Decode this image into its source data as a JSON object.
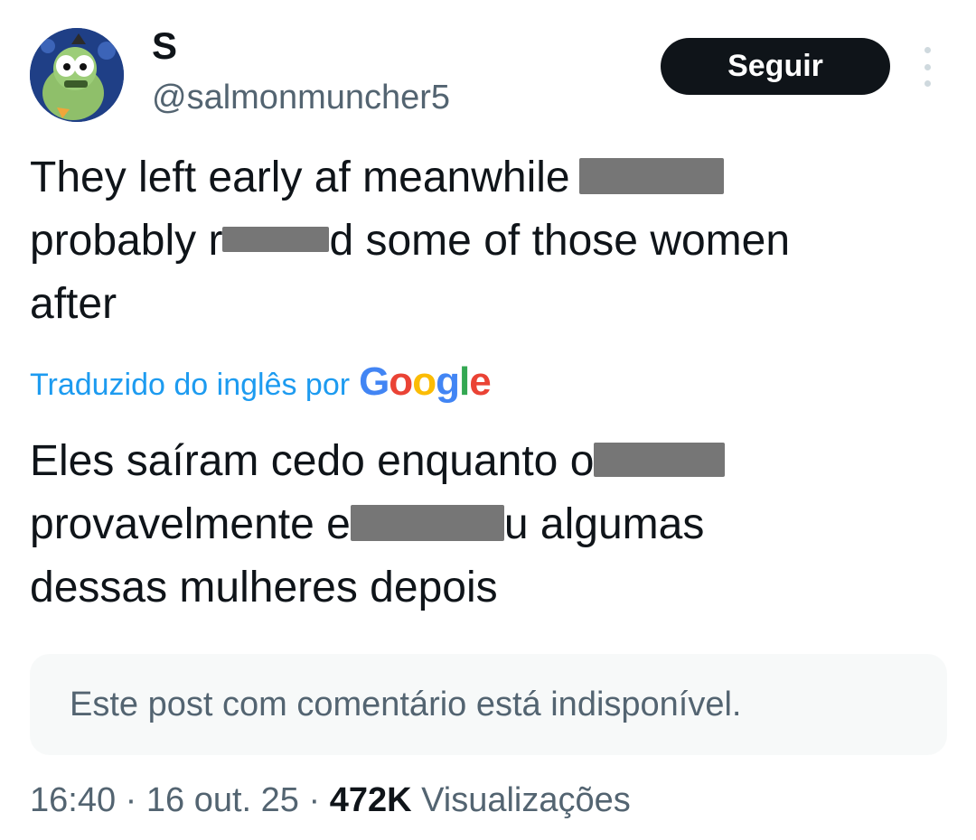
{
  "author": {
    "display_name": "S",
    "handle": "@salmonmuncher5"
  },
  "follow_button": {
    "label": "Seguir"
  },
  "tweet": {
    "segments": [
      "They left early af meanwhile",
      "probably r",
      "d some of those women",
      "after"
    ]
  },
  "translation": {
    "label": "Traduzido do inglês por",
    "provider": "Google",
    "segments": [
      "Eles saíram cedo enquanto o",
      "provavelmente e",
      "u algumas",
      "dessas mulheres depois"
    ]
  },
  "quoted_post": {
    "message": "Este post com comentário está indisponível."
  },
  "meta": {
    "time": "16:40",
    "separator": "·",
    "date": "16 out. 25",
    "views_count": "472K",
    "views_label": "Visualizações"
  },
  "colors": {
    "link": "#1d9bf0",
    "secondary_text": "#536471",
    "primary_text": "#0f1419",
    "follow_button_bg": "#0f1419"
  }
}
